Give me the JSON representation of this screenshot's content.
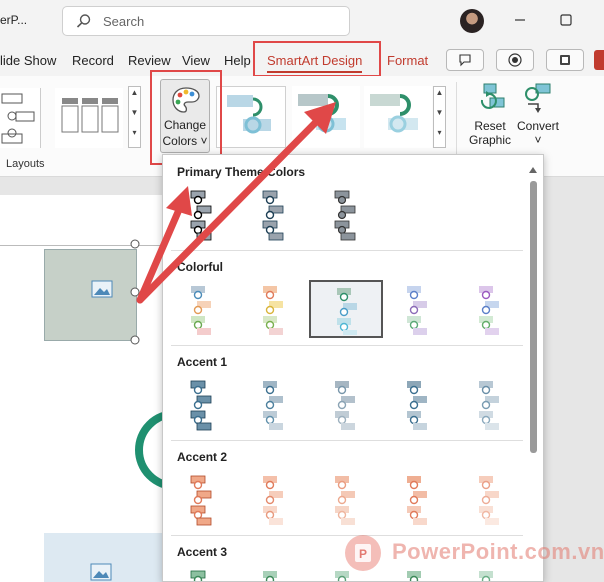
{
  "app": {
    "title_fragment": "erP..."
  },
  "search": {
    "placeholder": "Search"
  },
  "tabs": [
    {
      "label": "lide Show"
    },
    {
      "label": "Record"
    },
    {
      "label": "Review"
    },
    {
      "label": "View"
    },
    {
      "label": "Help"
    },
    {
      "label": "SmartArt Design"
    },
    {
      "label": "Format"
    }
  ],
  "ribbon": {
    "layouts_label": "Layouts",
    "change_colors_line1": "Change",
    "change_colors_line2": "Colors ˅",
    "reset_line1": "Reset",
    "reset_line2": "Graphic",
    "convert_line1": "Convert",
    "convert_line2": "˅"
  },
  "dropdown": {
    "sections": [
      {
        "title": "Primary Theme Colors"
      },
      {
        "title": "Colorful"
      },
      {
        "title": "Accent 1"
      },
      {
        "title": "Accent 2"
      },
      {
        "title": "Accent 3"
      }
    ]
  },
  "watermark": {
    "text": "PowerPoint.com.vn"
  },
  "colors": {
    "accent_red": "#c13b2e",
    "annotation_red": "#e04848",
    "accent1": "#3b6f8f",
    "accent2": "#e07a5a",
    "accent3": "#3d8a5a"
  }
}
